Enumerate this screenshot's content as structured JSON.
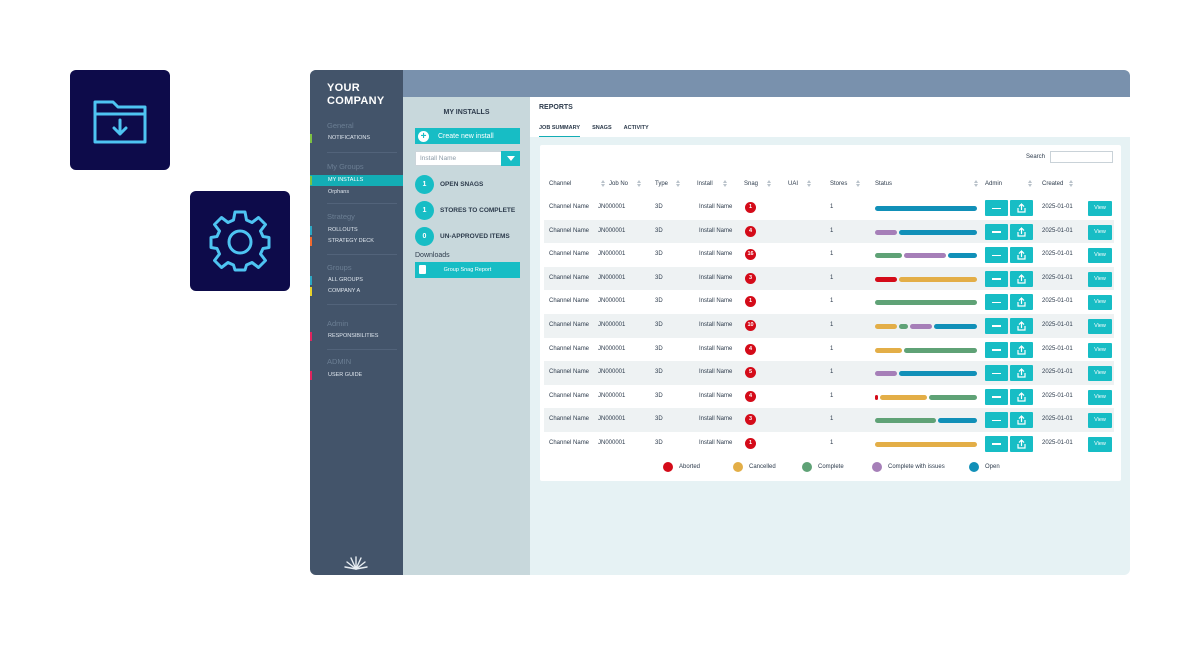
{
  "colors": {
    "aborted": "#d40b19",
    "cancelled": "#e3ae47",
    "complete": "#5fa276",
    "complete_with_issues": "#a67fb8",
    "open": "#1190b8",
    "accent": "#17bdc5",
    "sidebar": "#43546a",
    "topbar": "#7991ad"
  },
  "icons": {
    "folder": "folder-download-icon",
    "gear": "gear-icon"
  },
  "sidebar": {
    "brand_line1": "YOUR",
    "brand_line2": "COMPANY",
    "groups": {
      "general": "General",
      "my_groups": "My Groups",
      "strategy": "Strategy",
      "groups": "Groups",
      "admin": "Admin",
      "admin_caps": "ADMIN"
    },
    "items": {
      "notifications": "NOTIFICATIONS",
      "my_installs": "MY INSTALLS",
      "orphans": "Orphans",
      "rollouts": "ROLLOUTS",
      "strategy_deck": "STRATEGY DECK",
      "all_groups": "ALL GROUPS",
      "company_a": "COMPANY A",
      "responsibilities": "RESPONSIBILITIES",
      "user_guide": "USER GUIDE"
    }
  },
  "installs": {
    "title": "MY INSTALLS",
    "create_label": "Create new install",
    "select_placeholder": "Install Name",
    "open_snags_count": "1",
    "open_snags_label": "OPEN SNAGS",
    "stores_count": "1",
    "stores_label": "STORES TO COMPLETE",
    "unapproved_count": "0",
    "unapproved_label": "UN-APPROVED ITEMS",
    "downloads_label": "Downloads",
    "download_button": "Group Snag Report"
  },
  "reports": {
    "title": "REPORTS",
    "tabs": [
      "JOB SUMMARY",
      "SNAGS",
      "ACTIVITY"
    ],
    "search_label": "Search",
    "columns": {
      "channel": "Channel",
      "job_no": "Job No",
      "type": "Type",
      "install": "Install",
      "snag": "Snag",
      "uai": "UAI",
      "stores": "Stores",
      "status": "Status",
      "admin": "Admin",
      "created": "Created"
    },
    "view_label": "View",
    "rows": [
      {
        "channel": "Channel Name",
        "job": "JN000001",
        "type": "3D",
        "install": "Install Name",
        "snag": "1",
        "stores": "1",
        "created": "2025-01-01",
        "status": [
          {
            "s": "open",
            "w": 1.0
          }
        ]
      },
      {
        "channel": "Channel Name",
        "job": "JN000001",
        "type": "3D",
        "install": "Install Name",
        "snag": "4",
        "stores": "1",
        "created": "2025-01-01",
        "status": [
          {
            "s": "complete_with_issues",
            "w": 0.24
          },
          {
            "s": "open",
            "w": 0.76
          }
        ]
      },
      {
        "channel": "Channel Name",
        "job": "JN000001",
        "type": "3D",
        "install": "Install Name",
        "snag": "16",
        "stores": "1",
        "created": "2025-01-01",
        "status": [
          {
            "s": "complete",
            "w": 0.28
          },
          {
            "s": "complete_with_issues",
            "w": 0.44
          },
          {
            "s": "open",
            "w": 0.28
          }
        ]
      },
      {
        "channel": "Channel Name",
        "job": "JN000001",
        "type": "3D",
        "install": "Install Name",
        "snag": "3",
        "stores": "1",
        "created": "2025-01-01",
        "status": [
          {
            "s": "aborted",
            "w": 0.24
          },
          {
            "s": "cancelled",
            "w": 0.76
          }
        ]
      },
      {
        "channel": "Channel Name",
        "job": "JN000001",
        "type": "3D",
        "install": "Install Name",
        "snag": "1",
        "stores": "1",
        "created": "2025-01-01",
        "status": [
          {
            "s": "complete",
            "w": 1.0
          }
        ]
      },
      {
        "channel": "Channel Name",
        "job": "JN000001",
        "type": "3D",
        "install": "Install Name",
        "snag": "10",
        "stores": "1",
        "created": "2025-01-01",
        "status": [
          {
            "s": "cancelled",
            "w": 0.24
          },
          {
            "s": "complete",
            "w": 0.1
          },
          {
            "s": "complete_with_issues",
            "w": 0.24
          },
          {
            "s": "open",
            "w": 0.42
          }
        ]
      },
      {
        "channel": "Channel Name",
        "job": "JN000001",
        "type": "3D",
        "install": "Install Name",
        "snag": "4",
        "stores": "1",
        "created": "2025-01-01",
        "status": [
          {
            "s": "cancelled",
            "w": 0.28
          },
          {
            "s": "complete",
            "w": 0.72
          }
        ]
      },
      {
        "channel": "Channel Name",
        "job": "JN000001",
        "type": "3D",
        "install": "Install Name",
        "snag": "5",
        "stores": "1",
        "created": "2025-01-01",
        "status": [
          {
            "s": "complete_with_issues",
            "w": 0.24
          },
          {
            "s": "open",
            "w": 0.76
          }
        ]
      },
      {
        "channel": "Channel Name",
        "job": "JN000001",
        "type": "3D",
        "install": "Install Name",
        "snag": "4",
        "stores": "1",
        "created": "2025-01-01",
        "status": [
          {
            "s": "aborted",
            "w": 0.05
          },
          {
            "s": "cancelled",
            "w": 0.48
          },
          {
            "s": "complete",
            "w": 0.47
          }
        ]
      },
      {
        "channel": "Channel Name",
        "job": "JN000001",
        "type": "3D",
        "install": "Install Name",
        "snag": "3",
        "stores": "1",
        "created": "2025-01-01",
        "status": [
          {
            "s": "complete",
            "w": 0.62
          },
          {
            "s": "open",
            "w": 0.38
          }
        ]
      },
      {
        "channel": "Channel Name",
        "job": "JN000001",
        "type": "3D",
        "install": "Install Name",
        "snag": "1",
        "stores": "1",
        "created": "2025-01-01",
        "status": [
          {
            "s": "cancelled",
            "w": 1.0
          }
        ]
      }
    ],
    "legend": [
      {
        "key": "aborted",
        "label": "Aborted"
      },
      {
        "key": "cancelled",
        "label": "Cancelled"
      },
      {
        "key": "complete",
        "label": "Complete"
      },
      {
        "key": "complete_with_issues",
        "label": "Complete with issues"
      },
      {
        "key": "open",
        "label": "Open"
      }
    ]
  }
}
